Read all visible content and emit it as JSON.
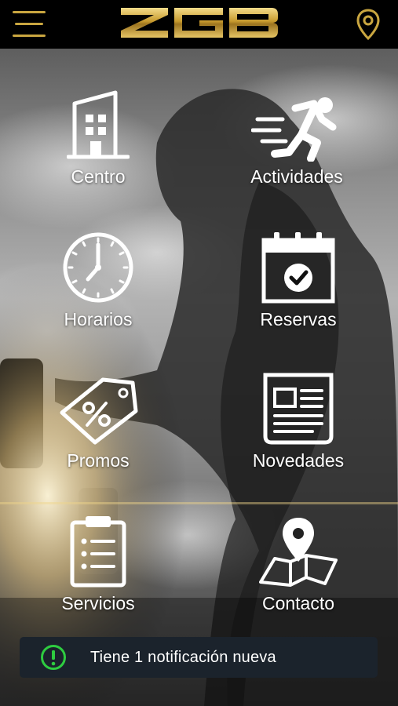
{
  "header": {
    "logo_text": "ZGB",
    "menu_icon": "hamburger-icon",
    "location_icon": "map-pin-icon"
  },
  "menu": {
    "items": [
      {
        "label": "Centro",
        "icon": "building-icon"
      },
      {
        "label": "Actividades",
        "icon": "running-person-icon"
      },
      {
        "label": "Horarios",
        "icon": "clock-icon"
      },
      {
        "label": "Reservas",
        "icon": "calendar-check-icon"
      },
      {
        "label": "Promos",
        "icon": "discount-tag-icon"
      },
      {
        "label": "Novedades",
        "icon": "newspaper-icon"
      },
      {
        "label": "Servicios",
        "icon": "clipboard-list-icon"
      },
      {
        "label": "Contacto",
        "icon": "map-location-icon"
      }
    ]
  },
  "notification": {
    "text": "Tiene 1 notificación nueva",
    "icon": "alert-circle-icon"
  },
  "colors": {
    "gold": "#c9a640",
    "notification_bg": "#1b232c",
    "alert_green": "#2ecc40"
  }
}
